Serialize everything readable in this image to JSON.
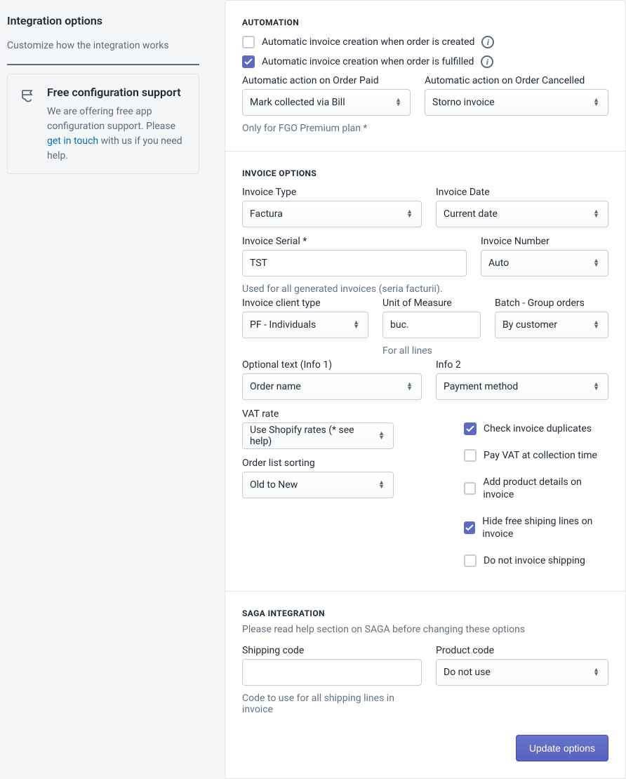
{
  "sidebar": {
    "title": "Integration options",
    "subtitle": "Customize how the integration works",
    "support": {
      "title": "Free configuration support",
      "text_prefix": "We are offering free app configuration support. Please ",
      "link_text": "get in touch",
      "text_suffix": " with us if you need help."
    }
  },
  "automation": {
    "heading": "AUTOMATION",
    "check_created": {
      "label": "Automatic invoice creation when order is created",
      "checked": false
    },
    "check_fulfilled": {
      "label": "Automatic invoice creation when order is fulfilled",
      "checked": true
    },
    "action_paid": {
      "label": "Automatic action on Order Paid",
      "value": "Mark collected via Bill"
    },
    "action_cancelled": {
      "label": "Automatic action on Order Cancelled",
      "value": "Storno invoice"
    },
    "note": "Only for FGO Premium plan *"
  },
  "invoice": {
    "heading": "INVOICE OPTIONS",
    "type": {
      "label": "Invoice Type",
      "value": "Factura"
    },
    "date": {
      "label": "Invoice Date",
      "value": "Current date"
    },
    "serial": {
      "label": "Invoice Serial *",
      "value": "TST",
      "help": "Used for all generated invoices (seria facturii)."
    },
    "number": {
      "label": "Invoice Number",
      "value": "Auto"
    },
    "client_type": {
      "label": "Invoice client type",
      "value": "PF - Individuals"
    },
    "uom": {
      "label": "Unit of Measure",
      "value": "buc.",
      "help": "For all lines"
    },
    "batch": {
      "label": "Batch - Group orders",
      "value": "By customer"
    },
    "info1": {
      "label": "Optional text (Info 1)",
      "value": "Order name"
    },
    "info2": {
      "label": "Info 2",
      "value": "Payment method"
    },
    "vat_rate": {
      "label": "VAT rate",
      "value": "Use Shopify rates (* see help)"
    },
    "sorting": {
      "label": "Order list sorting",
      "value": "Old to New"
    },
    "opts": {
      "duplicates": {
        "label": "Check invoice duplicates",
        "checked": true
      },
      "vat_collection": {
        "label": "Pay VAT at collection time",
        "checked": false
      },
      "product_details": {
        "label": "Add product details on invoice",
        "checked": false
      },
      "hide_free_shipping": {
        "label": "Hide free shiping lines on invoice",
        "checked": true
      },
      "no_shipping": {
        "label": "Do not invoice shipping",
        "checked": false
      }
    }
  },
  "saga": {
    "heading": "SAGA INTEGRATION",
    "sub": "Please read help section on SAGA before changing these options",
    "shipping_code": {
      "label": "Shipping code",
      "value": "",
      "help": "Code to use for all shipping lines in invoice"
    },
    "product_code": {
      "label": "Product code",
      "value": "Do not use"
    }
  },
  "footer": {
    "update": "Update options"
  }
}
